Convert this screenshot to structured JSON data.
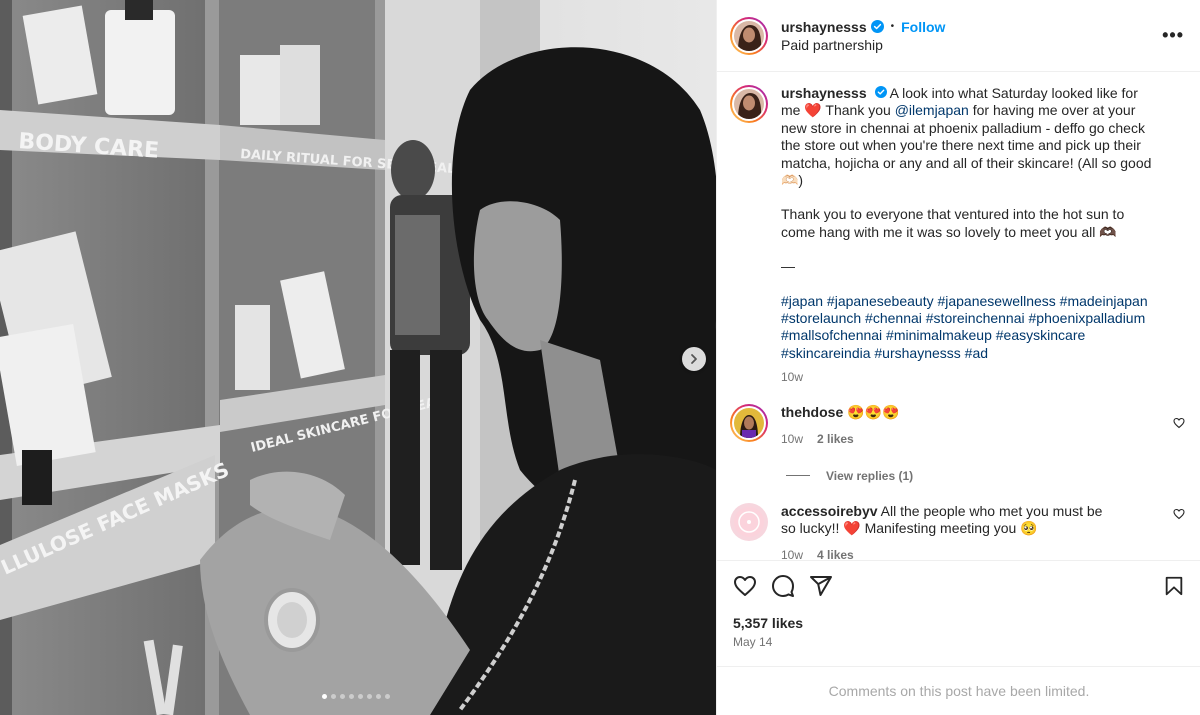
{
  "post": {
    "username": "urshaynesss",
    "follow_label": "Follow",
    "separator": "•",
    "partnership_label": "Paid partnership",
    "more_label": "•••"
  },
  "caption": {
    "username": "urshaynesss",
    "line1": "A look into what Saturday looked like for me",
    "heart": "❤️",
    "thank_prefix": "Thank you ",
    "mention": "@ilemjapan",
    "line2": " for having me over at your new store in chennai at phoenix palladium - deffo go check the store out when you're there next time and pick up their matcha, hojicha or any and all of their skincare! (All so good 🫶🏻)",
    "para2": "Thank you to everyone that ventured into the hot sun to come hang with me it was so lovely to meet you all 🫶🏿",
    "dash": "—",
    "hashtags": "#japan #japanesebeauty #japanesewellness #madeinjapan #storelaunch #chennai #storeinchennai #phoenixpalladium #mallsofchennai #minimalmakeup #easyskincare #skincareindia #urshaynesss #ad",
    "time": "10w"
  },
  "comments": [
    {
      "username": "thehdose",
      "text": "😍😍😍",
      "time": "10w",
      "likes": "2 likes"
    },
    {
      "username": "accessoirebyv",
      "text": "All the people who met you must be so lucky!! ❤️ Manifesting meeting you 🥺",
      "time": "10w",
      "likes": "4 likes"
    }
  ],
  "view_replies": "View replies (1)",
  "likes_count": "5,357 likes",
  "post_date": "May 14",
  "comments_limited": "Comments on this post have been limited.",
  "photo_text": {
    "sign_body_care": "BODY CARE",
    "sign_daily": "DAILY RITUAL FOR SELF-HEALING",
    "sign_ideal": "IDEAL SKINCARE FOR HEALTH",
    "sign_masks": "LLULOSE FACE MASKS"
  },
  "carousel": {
    "total": 8,
    "active": 1
  },
  "icons": {
    "verified": "verified-badge-icon",
    "like": "heart-icon",
    "comment": "comment-icon",
    "share": "share-icon",
    "save": "bookmark-icon",
    "next": "chevron-right-icon"
  },
  "colors": {
    "link": "#00376b",
    "follow": "#0095f6",
    "verified": "#0095f6",
    "muted": "#737373"
  }
}
